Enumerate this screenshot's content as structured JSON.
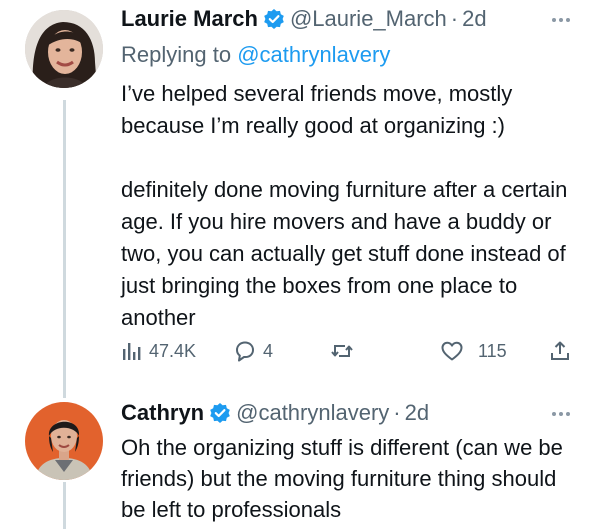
{
  "tweets": [
    {
      "name": "Laurie March",
      "handle": "@Laurie_March",
      "dot": "·",
      "time": "2d",
      "replying_prefix": "Replying to",
      "replying_to": "@cathrynlavery",
      "paragraph1": "I’ve helped several friends move, mostly because I’m really good at organizing :)",
      "paragraph2": "definitely done moving furniture after a certain age. If you hire movers and have a buddy or two, you can actually get stuff done instead of just bringing the boxes from one place to another",
      "stats": {
        "views": "47.4K",
        "replies": "4",
        "retweets": "",
        "likes": "115"
      },
      "icons": [
        "views-icon",
        "reply-icon",
        "retweet-icon",
        "like-icon",
        "share-icon",
        "verified-icon",
        "more-icon"
      ]
    },
    {
      "name": "Cathryn",
      "handle": "@cathrynlavery",
      "dot": "·",
      "time": "2d",
      "text": "Oh the organizing stuff is different (can we be friends) but the moving furniture thing should be left to professionals",
      "icons": [
        "verified-icon",
        "more-icon"
      ]
    }
  ],
  "colors": {
    "accent": "#1d9bf0",
    "secondary_text": "#536471",
    "thread_line": "#cfd9de"
  }
}
